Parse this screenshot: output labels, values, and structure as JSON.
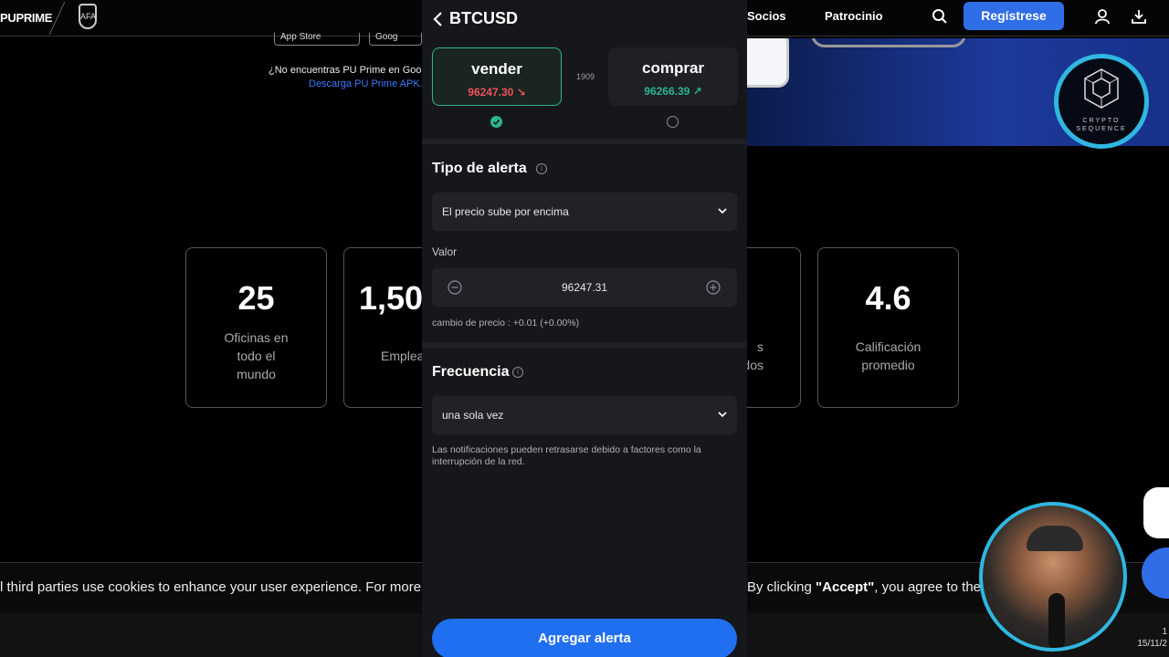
{
  "site": {
    "brand": "PUPRIME",
    "crest_text": "AFA",
    "nav": {
      "socios": "Socios",
      "patrocinio": "Patrocinio",
      "register": "Regístrese"
    },
    "store": {
      "app_store": "App Store",
      "google_play": "Goog"
    },
    "download_text": "¿No encuentras PU Prime en Goo",
    "download_link": "Descarga PU Prime APK.",
    "stats": [
      {
        "value": "25",
        "label": "Oficinas en todo el mundo"
      },
      {
        "value": "1,50",
        "label": "Emplea"
      },
      {
        "value": "",
        "label": "s\ndos"
      },
      {
        "value": "4.6",
        "label": "Calificación promedio"
      }
    ],
    "cookie_left": "l third parties use cookies to enhance your user experience. For more i",
    "cookie_right_pre": "By clicking ",
    "cookie_accept": "\"Accept\"",
    "cookie_right_post": ", you agree to the",
    "taskbar_time": "1",
    "taskbar_date": "15/11/2"
  },
  "logo": {
    "line1": "CRYPTO",
    "line2": "SEQUENCE"
  },
  "app": {
    "title": "BTCUSD",
    "sell": {
      "label": "vender",
      "price": "96247.30",
      "trend": "↘"
    },
    "buy": {
      "label": "comprar",
      "price": "96266.39",
      "trend": "↗"
    },
    "spread": "1909",
    "alert_type_title": "Tipo de alerta",
    "alert_type_value": "El precio sube por encima",
    "value_label": "Valor",
    "value": "96247.31",
    "price_change": "cambio de precio : +0.01 (+0.00%)",
    "frequency_title": "Frecuencia",
    "frequency_value": "una sola vez",
    "notice": "Las notificaciones pueden retrasarse debido a factores como la interrupción de la red.",
    "add_button": "Agregar alerta"
  },
  "colors": {
    "accent": "#1f6ff0",
    "sell": "#f0525b",
    "buy": "#2db58f",
    "panel": "#16171b"
  }
}
